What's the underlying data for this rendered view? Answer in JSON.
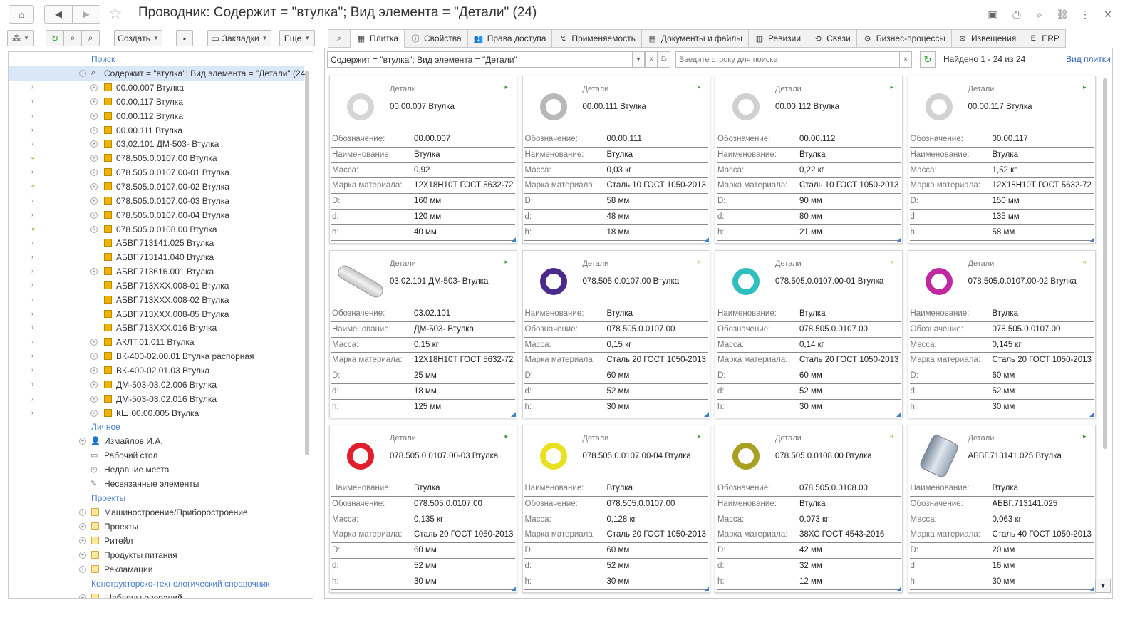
{
  "window": {
    "title": "Проводник: Содержит = \"втулка\"; Вид элемента = \"Детали\" (24)"
  },
  "toolbar": {
    "create_label": "Создать",
    "bookmarks_label": "Закладки",
    "more_label": "Еще"
  },
  "tabs": [
    {
      "label": "Плитка",
      "icon": "grid-icon"
    },
    {
      "label": "Свойства",
      "icon": "info-icon"
    },
    {
      "label": "Права доступа",
      "icon": "users-icon"
    },
    {
      "label": "Применяемость",
      "icon": "link-icon"
    },
    {
      "label": "Документы и файлы",
      "icon": "document-icon"
    },
    {
      "label": "Ревизии",
      "icon": "revision-icon"
    },
    {
      "label": "Связи",
      "icon": "relations-icon"
    },
    {
      "label": "Бизнес-процессы",
      "icon": "process-icon"
    },
    {
      "label": "Извещения",
      "icon": "notice-icon"
    },
    {
      "label": "ERP",
      "icon": "erp-icon"
    }
  ],
  "tree": {
    "section_search": "Поиск",
    "search_root": "Содержит = \"втулка\"; Вид элемента = \"Детали\" (24)",
    "results": [
      {
        "label": "00.00.007 Втулка",
        "exp": true,
        "mark": "arrow"
      },
      {
        "label": "00.00.117 Втулка",
        "exp": true,
        "mark": "arrow"
      },
      {
        "label": "00.00.112 Втулка",
        "exp": true,
        "mark": "arrow"
      },
      {
        "label": "00.00.111 Втулка",
        "exp": true,
        "mark": "arrow"
      },
      {
        "label": "03.02.101 ДМ-503- Втулка",
        "exp": true,
        "mark": "arrow"
      },
      {
        "label": "078.505.0.0107.00 Втулка",
        "exp": true,
        "mark": "double"
      },
      {
        "label": "078.505.0.0107.00-01 Втулка",
        "exp": true,
        "mark": "arrow"
      },
      {
        "label": "078.505.0.0107.00-02 Втулка",
        "exp": true,
        "mark": "double"
      },
      {
        "label": "078.505.0.0107.00-03 Втулка",
        "exp": true,
        "mark": "arrow"
      },
      {
        "label": "078.505.0.0107.00-04 Втулка",
        "exp": true,
        "mark": "arrow"
      },
      {
        "label": "078.505.0.0108.00 Втулка",
        "exp": true,
        "mark": "double"
      },
      {
        "label": "АБВГ.713141.025 Втулка",
        "exp": false,
        "mark": "arrow"
      },
      {
        "label": "АБВГ.713141.040 Втулка",
        "exp": false,
        "mark": "arrow"
      },
      {
        "label": "АБВГ.713616.001 Втулка",
        "exp": true,
        "mark": "arrow"
      },
      {
        "label": "АБВГ.713ХХХ.008-01 Втулка",
        "exp": false,
        "mark": "arrow"
      },
      {
        "label": "АБВГ.713ХХХ.008-02 Втулка",
        "exp": false,
        "mark": "arrow"
      },
      {
        "label": "АБВГ.713ХХХ.008-05 Втулка",
        "exp": false,
        "mark": "arrow"
      },
      {
        "label": "АБВГ.713ХХХ.016 Втулка",
        "exp": false,
        "mark": "arrow"
      },
      {
        "label": "АКЛТ.01.011 Втулка",
        "exp": true,
        "mark": "arrow"
      },
      {
        "label": "ВК-400-02.00.01 Втулка распорная",
        "exp": true,
        "mark": "arrow"
      },
      {
        "label": "ВК-400-02.01.03 Втулка",
        "exp": true,
        "mark": "arrow"
      },
      {
        "label": "ДМ-503-03.02.006 Втулка",
        "exp": true,
        "mark": "arrow"
      },
      {
        "label": "ДМ-503-03.02.016 Втулка",
        "exp": true,
        "mark": "arrow"
      },
      {
        "label": "КШ.00.00.005 Втулка",
        "exp": true,
        "mark": "arrow"
      }
    ],
    "section_personal": "Личное",
    "personal": [
      {
        "label": "Измайлов И.А.",
        "icon": "user-icon"
      },
      {
        "label": "Рабочий стол",
        "icon": "desktop-icon"
      },
      {
        "label": "Недавние места",
        "icon": "clock-icon"
      },
      {
        "label": "Несвязанные элементы",
        "icon": "unlinked-icon"
      }
    ],
    "section_projects": "Проекты",
    "projects": [
      {
        "label": "Машиностроение/Приборостроение"
      },
      {
        "label": "Проекты"
      },
      {
        "label": "Ритейл"
      },
      {
        "label": "Продукты питания"
      },
      {
        "label": "Рекламации"
      }
    ],
    "section_reference": "Конструкторско-технологический справочник",
    "reference": [
      {
        "label": "Шаблоны операций"
      }
    ]
  },
  "search": {
    "condition": "Содержит = \"втулка\"; Вид элемента = \"Детали\"",
    "placeholder": "Введите строку для поиска",
    "found": "Найдено 1 - 24 из 24",
    "view_link": "Вид плитки"
  },
  "cards": [
    {
      "cat": "Детали",
      "name": "00.00.007 Втулка",
      "status": "arrow",
      "color": "#d6d6d6",
      "shape": "ring",
      "props": [
        [
          "Обозначение:",
          "00.00.007"
        ],
        [
          "Наименование:",
          "Втулка"
        ],
        [
          "Масса:",
          "0,92"
        ],
        [
          "Марка материала:",
          "12Х18Н10Т ГОСТ 5632-72"
        ],
        [
          "D:",
          "160 мм"
        ],
        [
          "d:",
          "120 мм"
        ],
        [
          "h:",
          "40 мм"
        ]
      ]
    },
    {
      "cat": "Детали",
      "name": "00.00.111 Втулка",
      "status": "arrow",
      "color": "#b8b8b8",
      "shape": "ring",
      "props": [
        [
          "Обозначение:",
          "00.00.111"
        ],
        [
          "Наименование:",
          "Втулка"
        ],
        [
          "Масса:",
          "0,03 кг"
        ],
        [
          "Марка материала:",
          "Сталь 10 ГОСТ 1050-2013"
        ],
        [
          "D:",
          "58 мм"
        ],
        [
          "d:",
          "48 мм"
        ],
        [
          "h:",
          "18 мм"
        ]
      ]
    },
    {
      "cat": "Детали",
      "name": "00.00.112 Втулка",
      "status": "arrow",
      "color": "#d0d0d0",
      "shape": "ring",
      "props": [
        [
          "Обозначение:",
          "00.00.112"
        ],
        [
          "Наименование:",
          "Втулка"
        ],
        [
          "Масса:",
          "0,22 кг"
        ],
        [
          "Марка материала:",
          "Сталь 10 ГОСТ 1050-2013"
        ],
        [
          "D:",
          "90 мм"
        ],
        [
          "d:",
          "80 мм"
        ],
        [
          "h:",
          "21 мм"
        ]
      ]
    },
    {
      "cat": "Детали",
      "name": "00.00.117 Втулка",
      "status": "arrow",
      "color": "#d2d2d2",
      "shape": "ring",
      "props": [
        [
          "Обозначение:",
          "00.00.117"
        ],
        [
          "Наименование:",
          "Втулка"
        ],
        [
          "Масса:",
          "1,52 кг"
        ],
        [
          "Марка материала:",
          "12Х18Н10Т ГОСТ 5632-72"
        ],
        [
          "D:",
          "150 мм"
        ],
        [
          "d:",
          "135 мм"
        ],
        [
          "h:",
          "58 мм"
        ]
      ]
    },
    {
      "cat": "Детали",
      "name": "03.02.101 ДМ-503- Втулка",
      "status": "arrow",
      "color": "#c4c4c4",
      "shape": "tube",
      "props": [
        [
          "Обозначение:",
          "03.02.101"
        ],
        [
          "Наименование:",
          "ДМ-503- Втулка"
        ],
        [
          "Масса:",
          "0,15 кг"
        ],
        [
          "Марка материала:",
          "12Х18Н10Т ГОСТ 5632-72"
        ],
        [
          "D:",
          "25 мм"
        ],
        [
          "d:",
          "18 мм"
        ],
        [
          "h:",
          "125 мм"
        ]
      ]
    },
    {
      "cat": "Детали",
      "name": "078.505.0.0107.00 Втулка",
      "status": "double",
      "color": "#4a2a8a",
      "shape": "ring",
      "props": [
        [
          "Наименование:",
          "Втулка"
        ],
        [
          "Обозначение:",
          "078.505.0.0107.00"
        ],
        [
          "Масса:",
          "0,15 кг"
        ],
        [
          "Марка материала:",
          "Сталь 20 ГОСТ 1050-2013"
        ],
        [
          "D:",
          "60 мм"
        ],
        [
          "d:",
          "52 мм"
        ],
        [
          "h:",
          "30 мм"
        ]
      ]
    },
    {
      "cat": "Детали",
      "name": "078.505.0.0107.00-01 Втулка",
      "status": "double",
      "color": "#2fbfbf",
      "shape": "ring",
      "props": [
        [
          "Наименование:",
          "Втулка"
        ],
        [
          "Обозначение:",
          "078.505.0.0107.00"
        ],
        [
          "Масса:",
          "0,14 кг"
        ],
        [
          "Марка материала:",
          "Сталь 20 ГОСТ 1050-2013"
        ],
        [
          "D:",
          "60 мм"
        ],
        [
          "d:",
          "52 мм"
        ],
        [
          "h:",
          "30 мм"
        ]
      ]
    },
    {
      "cat": "Детали",
      "name": "078.505.0.0107.00-02 Втулка",
      "status": "double",
      "color": "#c02aa0",
      "shape": "ring",
      "props": [
        [
          "Наименование:",
          "Втулка"
        ],
        [
          "Обозначение:",
          "078.505.0.0107.00"
        ],
        [
          "Масса:",
          "0,145 кг"
        ],
        [
          "Марка материала:",
          "Сталь 20 ГОСТ 1050-2013"
        ],
        [
          "D:",
          "60 мм"
        ],
        [
          "d:",
          "52 мм"
        ],
        [
          "h:",
          "30 мм"
        ]
      ]
    },
    {
      "cat": "Детали",
      "name": "078.505.0.0107.00-03 Втулка",
      "status": "arrow",
      "color": "#e01f2a",
      "shape": "ring",
      "props": [
        [
          "Наименование:",
          "Втулка"
        ],
        [
          "Обозначение:",
          "078.505.0.0107.00"
        ],
        [
          "Масса:",
          "0,135 кг"
        ],
        [
          "Марка материала:",
          "Сталь 20 ГОСТ 1050-2013"
        ],
        [
          "D:",
          "60 мм"
        ],
        [
          "d:",
          "52 мм"
        ],
        [
          "h:",
          "30 мм"
        ]
      ]
    },
    {
      "cat": "Детали",
      "name": "078.505.0.0107.00-04 Втулка",
      "status": "arrow",
      "color": "#e8e020",
      "shape": "ring",
      "props": [
        [
          "Наименование:",
          "Втулка"
        ],
        [
          "Обозначение:",
          "078.505.0.0107.00"
        ],
        [
          "Масса:",
          "0,128 кг"
        ],
        [
          "Марка материала:",
          "Сталь 20 ГОСТ 1050-2013"
        ],
        [
          "D:",
          "60 мм"
        ],
        [
          "d:",
          "52 мм"
        ],
        [
          "h:",
          "30 мм"
        ]
      ]
    },
    {
      "cat": "Детали",
      "name": "078.505.0.0108.00 Втулка",
      "status": "double",
      "color": "#a8a020",
      "shape": "ring",
      "props": [
        [
          "Обозначение:",
          "078.505.0.0108.00"
        ],
        [
          "Наименование:",
          "Втулка"
        ],
        [
          "Масса:",
          "0,073 кг"
        ],
        [
          "Марка материала:",
          "38ХС ГОСТ 4543-2016"
        ],
        [
          "D:",
          "42 мм"
        ],
        [
          "d:",
          "32 мм"
        ],
        [
          "h:",
          "12 мм"
        ]
      ]
    },
    {
      "cat": "Детали",
      "name": "АБВГ.713141.025 Втулка",
      "status": "arrow",
      "color": "#9aa8b8",
      "shape": "cyl",
      "props": [
        [
          "Наименование:",
          "Втулка"
        ],
        [
          "Обозначение:",
          "АБВГ.713141.025"
        ],
        [
          "Масса:",
          "0,063 кг"
        ],
        [
          "Марка материала:",
          "Сталь 40 ГОСТ 1050-2013"
        ],
        [
          "D:",
          "20 мм"
        ],
        [
          "d:",
          "16 мм"
        ],
        [
          "h:",
          "30 мм"
        ]
      ]
    }
  ]
}
